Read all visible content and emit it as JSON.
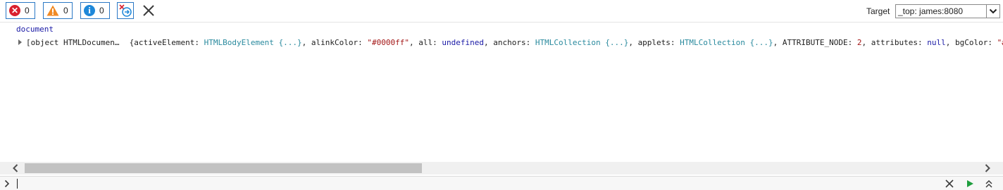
{
  "toolbar": {
    "errors_count": "0",
    "warnings_count": "0",
    "messages_count": "0",
    "target_label": "Target",
    "target_value": "_top: james:8080"
  },
  "console": {
    "command": "document",
    "result_label": "[object HTMLDocumen…",
    "properties": [
      {
        "key": "activeElement",
        "value": "HTMLBodyElement {...}",
        "kind": "type"
      },
      {
        "key": "alinkColor",
        "value": "\"#0000ff\"",
        "kind": "string"
      },
      {
        "key": "all",
        "value": "undefined",
        "kind": "keyword"
      },
      {
        "key": "anchors",
        "value": "HTMLCollection {...}",
        "kind": "type"
      },
      {
        "key": "applets",
        "value": "HTMLCollection {...}",
        "kind": "type"
      },
      {
        "key": "ATTRIBUTE_NODE",
        "value": "2",
        "kind": "number"
      },
      {
        "key": "attributes",
        "value": "null",
        "kind": "keyword"
      },
      {
        "key": "bgColor",
        "value": "\"#",
        "kind": "string"
      }
    ]
  },
  "colors": {
    "accent_border": "#2b78c5",
    "error": "#d9202e",
    "warning": "#f08a24",
    "info": "#1e88d9",
    "string": "#a31515",
    "type": "#2a8a9e",
    "keyword": "#1a1aa6"
  },
  "icons": [
    "error-icon",
    "warning-icon",
    "info-icon",
    "clear-on-navigate-icon",
    "clear-console-icon",
    "chevron-down-icon",
    "scroll-left-icon",
    "scroll-right-icon",
    "prompt-icon",
    "clear-input-icon",
    "run-icon",
    "expand-input-icon"
  ]
}
